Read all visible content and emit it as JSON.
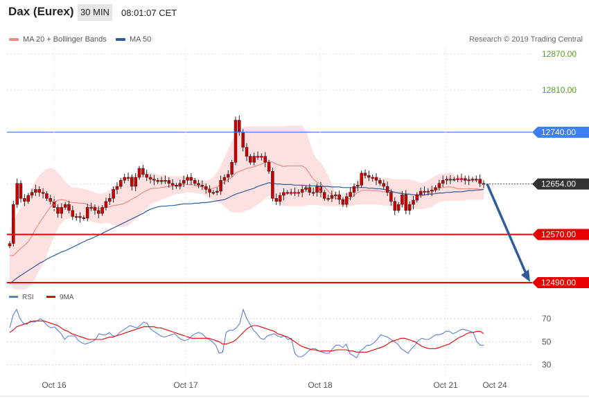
{
  "header": {
    "title": "Dax (Eurex)",
    "timeframe": "30 MIN",
    "time": "08:01:07 CET"
  },
  "legend": {
    "items": [
      {
        "label": "MA 20 + Bollinger Bands",
        "color": "#f08a8a"
      },
      {
        "label": "MA 50",
        "color": "#2f5b99"
      }
    ],
    "credit": "Research © 2019 Trading Central"
  },
  "colors": {
    "candle": "#cc0000",
    "band_fill": "#fde0e0",
    "ma20": "#f08a8a",
    "ma50": "#2f5b99",
    "resistance": "#3d7ef0",
    "support": "#e60000",
    "current": "#333333",
    "projection": "#2f5b99",
    "rsi": "#5b7fd6",
    "rsi_ma": "#e60000",
    "green_level": "#5a9e1c"
  },
  "chart_data": [
    {
      "type": "candlestick",
      "title": "Dax (Eurex)",
      "ylim": [
        12470,
        12885
      ],
      "x_tick_labels": [
        "Oct 16",
        "Oct 17",
        "Oct 18",
        "Oct 21",
        "Oct 24"
      ],
      "price_levels": [
        {
          "value": 12870,
          "label": "12870.00",
          "style": "green"
        },
        {
          "value": 12810,
          "label": "12810.00",
          "style": "green"
        },
        {
          "value": 12740,
          "label": "12740.00",
          "style": "resistance"
        },
        {
          "value": 12654,
          "label": "12654.00",
          "style": "current"
        },
        {
          "value": 12570,
          "label": "12570.00",
          "style": "support"
        },
        {
          "value": 12490,
          "label": "12490.00",
          "style": "support"
        }
      ],
      "close": [
        12555,
        12620,
        12655,
        12630,
        12625,
        12635,
        12640,
        12645,
        12640,
        12638,
        12630,
        12625,
        12615,
        12605,
        12615,
        12620,
        12610,
        12600,
        12600,
        12598,
        12597,
        12615,
        12615,
        12610,
        12605,
        12615,
        12625,
        12630,
        12645,
        12650,
        12660,
        12665,
        12665,
        12650,
        12665,
        12680,
        12670,
        12665,
        12662,
        12660,
        12658,
        12660,
        12660,
        12655,
        12652,
        12650,
        12655,
        12660,
        12665,
        12660,
        12655,
        12652,
        12650,
        12645,
        12640,
        12640,
        12642,
        12660,
        12665,
        12670,
        12690,
        12760,
        12740,
        12715,
        12700,
        12690,
        12700,
        12700,
        12700,
        12690,
        12675,
        12630,
        12625,
        12635,
        12640,
        12640,
        12640,
        12640,
        12640,
        12645,
        12648,
        12640,
        12640,
        12650,
        12640,
        12630,
        12630,
        12635,
        12636,
        12628,
        12620,
        12633,
        12640,
        12650,
        12652,
        12672,
        12668,
        12665,
        12665,
        12660,
        12655,
        12650,
        12640,
        12625,
        12610,
        12620,
        12636,
        12610,
        12620,
        12627,
        12636,
        12642,
        12642,
        12642,
        12644,
        12648,
        12655,
        12660,
        12662,
        12662,
        12662,
        12663,
        12663,
        12660,
        12661,
        12662,
        12662,
        12655,
        12654
      ],
      "band_upper": [
        12580,
        12590,
        12605,
        12615,
        12625,
        12635,
        12648,
        12660,
        12668,
        12674,
        12679,
        12681,
        12679,
        12673,
        12666,
        12658,
        12652,
        12648,
        12648,
        12647,
        12646,
        12644,
        12642,
        12640,
        12638,
        12638,
        12640,
        12644,
        12650,
        12654,
        12658,
        12662,
        12666,
        12668,
        12670,
        12672,
        12673,
        12673,
        12672,
        12671,
        12670,
        12669,
        12668,
        12667,
        12667,
        12667,
        12667,
        12667,
        12667,
        12666,
        12664,
        12662,
        12660,
        12660,
        12661,
        12666,
        12674,
        12684,
        12698,
        12712,
        12724,
        12738,
        12745,
        12748,
        12750,
        12750,
        12750,
        12750,
        12750,
        12750,
        12750,
        12750,
        12750,
        12750,
        12750,
        12751,
        12751,
        12751,
        12751,
        12751,
        12742,
        12724,
        12705,
        12695,
        12690,
        12680,
        12668,
        12654,
        12642,
        12640,
        12640,
        12640,
        12644,
        12652,
        12660,
        12666,
        12668,
        12668,
        12667,
        12666,
        12665,
        12664,
        12664,
        12663,
        12662,
        12662,
        12662,
        12662,
        12662,
        12660,
        12658,
        12656,
        12657,
        12660,
        12664,
        12668,
        12670,
        12671,
        12672,
        12673,
        12670,
        12667,
        12666,
        12665,
        12664,
        12664,
        12664,
        12663,
        12663
      ],
      "band_lower": [
        12490,
        12480,
        12478,
        12479,
        12478,
        12481,
        12488,
        12498,
        12510,
        12522,
        12536,
        12551,
        12566,
        12580,
        12589,
        12595,
        12597,
        12598,
        12599,
        12598,
        12597,
        12595,
        12592,
        12590,
        12588,
        12588,
        12590,
        12588,
        12586,
        12584,
        12582,
        12583,
        12585,
        12590,
        12595,
        12600,
        12608,
        12614,
        12620,
        12623,
        12625,
        12628,
        12630,
        12633,
        12635,
        12637,
        12638,
        12639,
        12640,
        12640,
        12639,
        12638,
        12637,
        12634,
        12630,
        12627,
        12624,
        12622,
        12617,
        12610,
        12607,
        12606,
        12606,
        12607,
        12610,
        12612,
        12616,
        12620,
        12624,
        12630,
        12635,
        12630,
        12625,
        12620,
        12617,
        12617,
        12617,
        12617,
        12617,
        12617,
        12618,
        12619,
        12619,
        12619,
        12618,
        12618,
        12617,
        12617,
        12617,
        12617,
        12616,
        12616,
        12617,
        12618,
        12620,
        12620,
        12620,
        12620,
        12620,
        12620,
        12619,
        12618,
        12618,
        12618,
        12617,
        12616,
        12615,
        12614,
        12613,
        12613,
        12612,
        12612,
        12613,
        12614,
        12616,
        12620,
        12624,
        12625,
        12626,
        12626,
        12626,
        12626,
        12626,
        12627,
        12628,
        12628,
        12628,
        12628,
        12628
      ],
      "ma20": [
        12535,
        12535,
        12541,
        12547,
        12552,
        12558,
        12568,
        12579,
        12589,
        12598,
        12607,
        12616,
        12622,
        12627,
        12628,
        12627,
        12624,
        12623,
        12623,
        12622,
        12622,
        12620,
        12617,
        12615,
        12613,
        12613,
        12615,
        12616,
        12618,
        12619,
        12620,
        12622,
        12625,
        12629,
        12632,
        12636,
        12640,
        12643,
        12646,
        12647,
        12647,
        12648,
        12649,
        12650,
        12651,
        12652,
        12652,
        12653,
        12653,
        12653,
        12652,
        12650,
        12649,
        12647,
        12646,
        12647,
        12649,
        12653,
        12657,
        12661,
        12665,
        12672,
        12675,
        12677,
        12680,
        12681,
        12683,
        12685,
        12687,
        12690,
        12692,
        12690,
        12687,
        12685,
        12683,
        12684,
        12684,
        12684,
        12684,
        12684,
        12680,
        12671,
        12662,
        12657,
        12654,
        12649,
        12642,
        12636,
        12630,
        12629,
        12628,
        12628,
        12630,
        12635,
        12640,
        12643,
        12644,
        12644,
        12643,
        12643,
        12642,
        12641,
        12641,
        12640,
        12640,
        12639,
        12638,
        12638,
        12637,
        12636,
        12635,
        12634,
        12635,
        12637,
        12640,
        12644,
        12647,
        12648,
        12649,
        12649,
        12648,
        12646,
        12646,
        12646,
        12646,
        12646,
        12646,
        12645,
        12645
      ],
      "ma50": [
        12488,
        12493,
        12498,
        12502,
        12506,
        12510,
        12514,
        12518,
        12522,
        12525,
        12529,
        12532,
        12535,
        12538,
        12541,
        12543,
        12546,
        12549,
        12552,
        12555,
        12558,
        12561,
        12563,
        12566,
        12569,
        12572,
        12575,
        12578,
        12581,
        12584,
        12587,
        12590,
        12593,
        12596,
        12599,
        12602,
        12605,
        12609,
        12612,
        12614,
        12616,
        12617,
        12617,
        12618,
        12618,
        12619,
        12620,
        12621,
        12621,
        12621,
        12622,
        12622,
        12623,
        12623,
        12624,
        12625,
        12626,
        12627,
        12628,
        12631,
        12634,
        12637,
        12639,
        12641,
        12643,
        12645,
        12647,
        12650,
        12652,
        12654,
        12656,
        12655,
        12654,
        12654,
        12653,
        12653,
        12653,
        12652,
        12652,
        12652,
        12651,
        12651,
        12651,
        12651,
        12650,
        12650,
        12650,
        12649,
        12649,
        12649,
        12648,
        12648,
        12648,
        12648,
        12648,
        12648,
        12648,
        12647,
        12647,
        12646,
        12646,
        12645,
        12644,
        12642,
        12640,
        12639,
        12638,
        12637,
        12637,
        12636,
        12636,
        12636,
        12636,
        12637,
        12637,
        12638,
        12639,
        12639,
        12640,
        12640,
        12641,
        12641,
        12641,
        12642,
        12643,
        12643,
        12644,
        12644,
        12645
      ],
      "projection": [
        {
          "from": 12654,
          "to": 12490
        }
      ]
    },
    {
      "type": "line",
      "title": "RSI",
      "ylim": [
        22,
        82
      ],
      "y_ticks": [
        30,
        50,
        70
      ],
      "series": [
        {
          "name": "RSI",
          "color": "#5b7fd6",
          "values": [
            62,
            73,
            78,
            70,
            66,
            65,
            68,
            67,
            68,
            70,
            67,
            64,
            62,
            63,
            60,
            57,
            52,
            55,
            55,
            55,
            51,
            49,
            48,
            49,
            50,
            52,
            57,
            56,
            56,
            58,
            55,
            55,
            58,
            60,
            62,
            64,
            63,
            62,
            64,
            67,
            66,
            61,
            59,
            57,
            55,
            54,
            55,
            56,
            57,
            54,
            52,
            51,
            52,
            55,
            57,
            58,
            57,
            54,
            52,
            50,
            47,
            40,
            41,
            58,
            60,
            60,
            62,
            66,
            78,
            70,
            65,
            60,
            57,
            53,
            52,
            55,
            56,
            57,
            55,
            54,
            55,
            52,
            53,
            40,
            37,
            37,
            39,
            42,
            44,
            44,
            42,
            41,
            40,
            40,
            44,
            47,
            47,
            45,
            48,
            40,
            38,
            36,
            42,
            44,
            47,
            47,
            49,
            52,
            56,
            55,
            54,
            52,
            50,
            48,
            44,
            42,
            40,
            44,
            47,
            51,
            53,
            52,
            52,
            54,
            56,
            56,
            57,
            59,
            59,
            57,
            58,
            60,
            61,
            60,
            59,
            58,
            50,
            47,
            47
          ]
        },
        {
          "name": "9MA",
          "color": "#e60000",
          "values": [
            58,
            60,
            63,
            64,
            65,
            66,
            67,
            68,
            68,
            68,
            68,
            67,
            66,
            65,
            64,
            62,
            60,
            59,
            57,
            56,
            55,
            54,
            53,
            52,
            52,
            52,
            52,
            52,
            53,
            54,
            54,
            55,
            56,
            57,
            58,
            59,
            60,
            61,
            62,
            63,
            63,
            63,
            63,
            62,
            62,
            61,
            60,
            59,
            58,
            57,
            56,
            55,
            54,
            53,
            53,
            53,
            53,
            53,
            53,
            52,
            51,
            50,
            48,
            48,
            49,
            50,
            52,
            55,
            58,
            61,
            63,
            64,
            64,
            63,
            62,
            61,
            60,
            59,
            57,
            56,
            55,
            54,
            52,
            50,
            48,
            46,
            45,
            44,
            43,
            43,
            42,
            42,
            42,
            42,
            42,
            43,
            43,
            43,
            43,
            42,
            42,
            41,
            41,
            41,
            41,
            42,
            43,
            44,
            45,
            46,
            48,
            50,
            51,
            52,
            53,
            53,
            52,
            51,
            50,
            48,
            46,
            45,
            44,
            44,
            44,
            45,
            46,
            47,
            48,
            50,
            52,
            54,
            55,
            57,
            58,
            58,
            59,
            59,
            57
          ]
        }
      ],
      "x_tick_labels": [
        "Oct 16",
        "Oct 17",
        "Oct 18",
        "Oct 21",
        "Oct 24"
      ]
    }
  ]
}
